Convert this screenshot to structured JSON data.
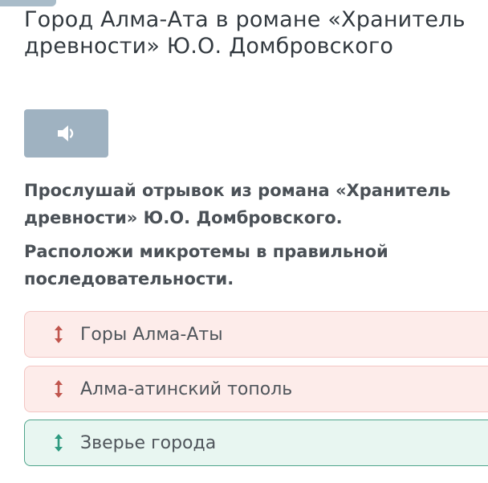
{
  "header": {
    "title": "Город Алма-Ата в романе «Хранитель древности» Ю.О. Домбровского"
  },
  "audio": {
    "icon": "speaker-icon",
    "button_color": "#9fb2c1"
  },
  "instructions": [
    "Прослушай отрывок из романа «Хранитель древности» Ю.О. Домбровского.",
    "Расположи микротемы в правильной последовательности."
  ],
  "sortable_items": [
    {
      "label": "Горы Алма-Аты",
      "status": "incorrect",
      "icon": "drag-handle-icon"
    },
    {
      "label": "Алма-атинский тополь",
      "status": "incorrect",
      "icon": "drag-handle-icon"
    },
    {
      "label": "Зверье города",
      "status": "correct",
      "icon": "drag-handle-icon"
    }
  ],
  "colors": {
    "incorrect_bg": "#fdecea",
    "incorrect_border": "#f3c6c3",
    "incorrect_icon": "#c0554d",
    "correct_bg": "#e8f6f1",
    "correct_border": "#4fa48b",
    "correct_icon": "#2e9a80"
  }
}
